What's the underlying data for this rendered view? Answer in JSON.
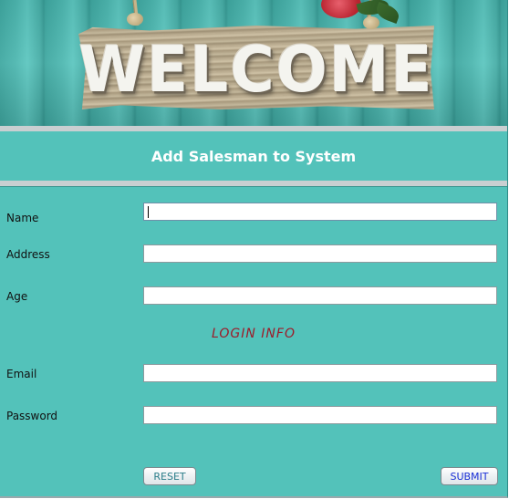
{
  "banner": {
    "sign_text": "WELCOME"
  },
  "header": {
    "title": "Add Salesman to System"
  },
  "form": {
    "fields": [
      {
        "label": "Name",
        "value": ""
      },
      {
        "label": "Address",
        "value": ""
      },
      {
        "label": "Age",
        "value": ""
      },
      {
        "label": "Email",
        "value": ""
      },
      {
        "label": "Password",
        "value": ""
      }
    ],
    "section_title": "LOGIN INFO"
  },
  "buttons": {
    "reset": "RESET",
    "submit": "SUBMIT"
  },
  "colors": {
    "background": "#53c2ba",
    "section_title": "#9c1c2a",
    "submit_text": "#1a2fd6",
    "reset_text": "#2c7e8a"
  }
}
